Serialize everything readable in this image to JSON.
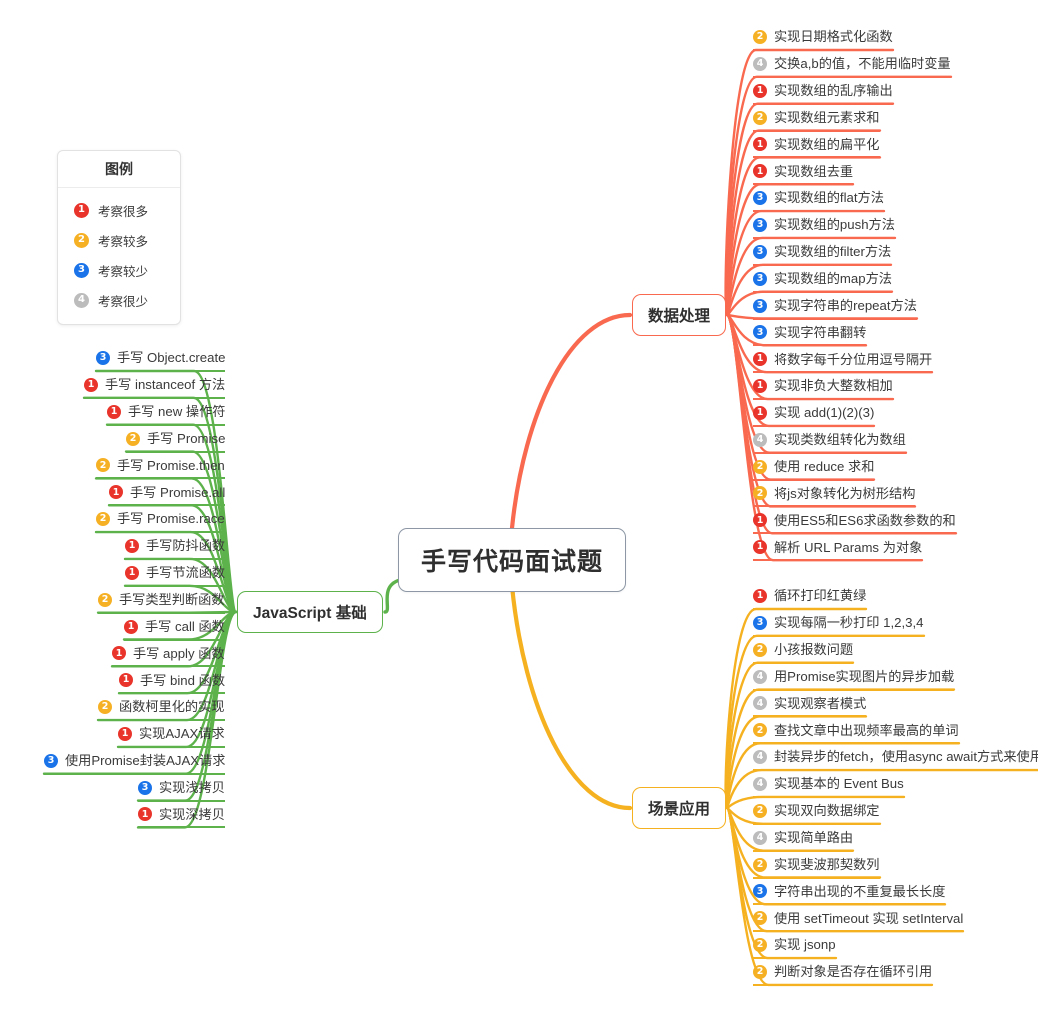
{
  "root": {
    "label": "手写代码面试题"
  },
  "legend": {
    "title": "图例",
    "rows": [
      {
        "level": "1",
        "label": "考察很多"
      },
      {
        "level": "2",
        "label": "考察较多"
      },
      {
        "level": "3",
        "label": "考察较少"
      },
      {
        "level": "4",
        "label": "考察很少"
      }
    ]
  },
  "branches": [
    {
      "id": "data-processing",
      "label": "数据处理",
      "color": "#f9694f",
      "side": "right",
      "items": [
        {
          "level": "2",
          "label": "实现日期格式化函数"
        },
        {
          "level": "4",
          "label": "交换a,b的值，不能用临时变量"
        },
        {
          "level": "1",
          "label": "实现数组的乱序输出"
        },
        {
          "level": "2",
          "label": "实现数组元素求和"
        },
        {
          "level": "1",
          "label": "实现数组的扁平化"
        },
        {
          "level": "1",
          "label": "实现数组去重"
        },
        {
          "level": "3",
          "label": "实现数组的flat方法"
        },
        {
          "level": "3",
          "label": "实现数组的push方法"
        },
        {
          "level": "3",
          "label": "实现数组的filter方法"
        },
        {
          "level": "3",
          "label": "实现数组的map方法"
        },
        {
          "level": "3",
          "label": "实现字符串的repeat方法"
        },
        {
          "level": "3",
          "label": "实现字符串翻转"
        },
        {
          "level": "1",
          "label": "将数字每千分位用逗号隔开"
        },
        {
          "level": "1",
          "label": "实现非负大整数相加"
        },
        {
          "level": "1",
          "label": "实现 add(1)(2)(3)"
        },
        {
          "level": "4",
          "label": "实现类数组转化为数组"
        },
        {
          "level": "2",
          "label": "使用 reduce 求和"
        },
        {
          "level": "2",
          "label": "将js对象转化为树形结构"
        },
        {
          "level": "1",
          "label": "使用ES5和ES6求函数参数的和"
        },
        {
          "level": "1",
          "label": "解析 URL Params 为对象"
        }
      ]
    },
    {
      "id": "scenario-application",
      "label": "场景应用",
      "color": "#f5b120",
      "side": "right",
      "items": [
        {
          "level": "1",
          "label": "循环打印红黄绿"
        },
        {
          "level": "3",
          "label": "实现每隔一秒打印 1,2,3,4"
        },
        {
          "level": "2",
          "label": "小孩报数问题"
        },
        {
          "level": "4",
          "label": "用Promise实现图片的异步加载"
        },
        {
          "level": "4",
          "label": "实现观察者模式"
        },
        {
          "level": "2",
          "label": "查找文章中出现频率最高的单词"
        },
        {
          "level": "4",
          "label": "封装异步的fetch，使用async await方式来使用"
        },
        {
          "level": "4",
          "label": "实现基本的 Event Bus"
        },
        {
          "level": "2",
          "label": "实现双向数据绑定"
        },
        {
          "level": "4",
          "label": "实现简单路由"
        },
        {
          "level": "2",
          "label": "实现斐波那契数列"
        },
        {
          "level": "3",
          "label": "字符串出现的不重复最长长度"
        },
        {
          "level": "2",
          "label": "使用 setTimeout 实现 setInterval"
        },
        {
          "level": "2",
          "label": "实现 jsonp"
        },
        {
          "level": "2",
          "label": "判断对象是否存在循环引用"
        }
      ]
    },
    {
      "id": "javascript-basics",
      "label": "JavaScript 基础",
      "color": "#5db24c",
      "side": "left",
      "items": [
        {
          "level": "3",
          "label": "手写 Object.create"
        },
        {
          "level": "1",
          "label": "手写 instanceof 方法"
        },
        {
          "level": "1",
          "label": "手写 new 操作符"
        },
        {
          "level": "2",
          "label": "手写 Promise"
        },
        {
          "level": "2",
          "label": "手写 Promise.then"
        },
        {
          "level": "1",
          "label": "手写 Promise.all"
        },
        {
          "level": "2",
          "label": "手写 Promise.race"
        },
        {
          "level": "1",
          "label": "手写防抖函数"
        },
        {
          "level": "1",
          "label": "手写节流函数"
        },
        {
          "level": "2",
          "label": "手写类型判断函数"
        },
        {
          "level": "1",
          "label": "手写 call 函数"
        },
        {
          "level": "1",
          "label": "手写 apply 函数"
        },
        {
          "level": "1",
          "label": "手写 bind 函数"
        },
        {
          "level": "2",
          "label": "函数柯里化的实现"
        },
        {
          "level": "1",
          "label": "实现AJAX请求"
        },
        {
          "level": "3",
          "label": "使用Promise封装AJAX请求"
        },
        {
          "level": "3",
          "label": "实现浅拷贝"
        },
        {
          "level": "1",
          "label": "实现深拷贝"
        }
      ]
    }
  ]
}
